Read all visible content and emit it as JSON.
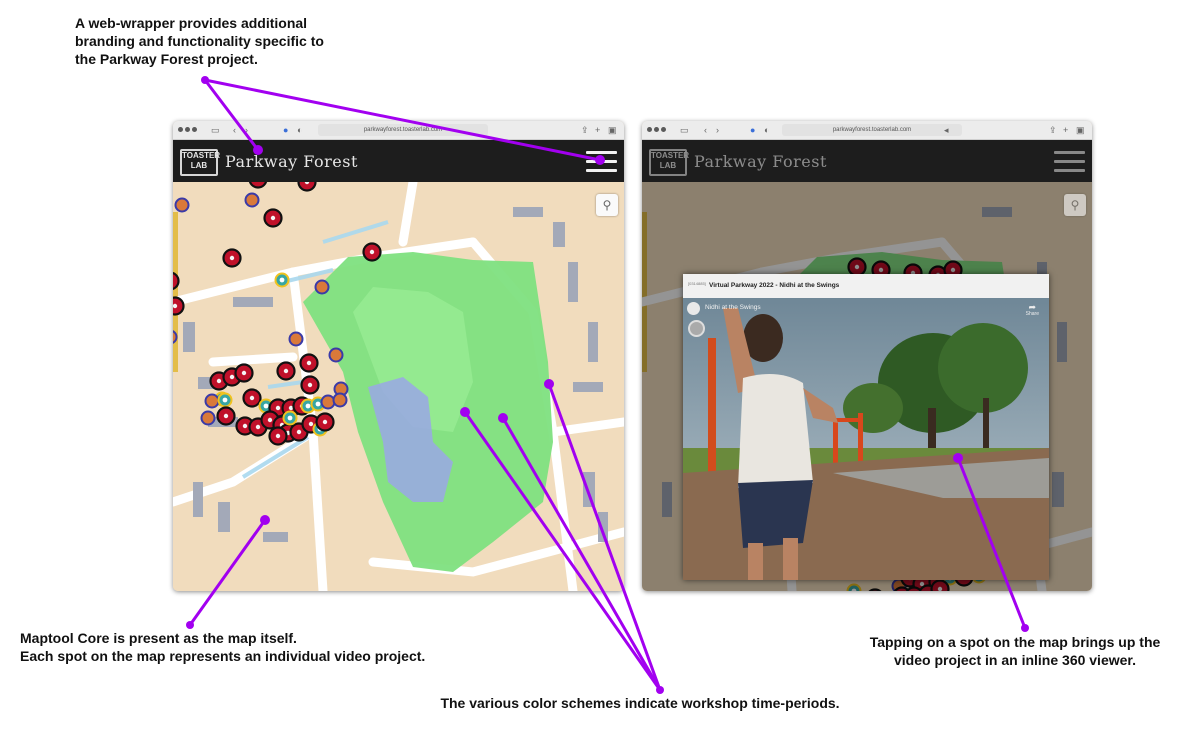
{
  "annotations": {
    "top": [
      "A web-wrapper provides additional",
      "branding and functionality specific to",
      "the Parkway Forest project."
    ],
    "left": [
      "Maptool Core is present as the map itself.",
      "Each spot on the map represents an individual video project."
    ],
    "right": [
      "Tapping on a spot on the map brings up the",
      "video project in an inline 360 viewer."
    ],
    "bottom": "The various color schemes indicate workshop time-periods.",
    "arrow_color": "#a200f0"
  },
  "browser_left": {
    "url": "parkwayforest.toasterlab.com",
    "app": {
      "logo_top": "TOASTER",
      "logo_bottom": "LAB",
      "title": "Parkway Forest"
    }
  },
  "browser_right": {
    "url": "parkwayforest.toasterlab.com",
    "app": {
      "logo_top": "TOASTER",
      "logo_bottom": "LAB",
      "title": "Parkway Forest"
    },
    "viewer": {
      "id_label": "[0314885]",
      "title": "Virtual Parkway 2022 - Nidhi at the Swings",
      "video_title": "Nidhi at the Swings",
      "share_label": "Share"
    }
  },
  "icons": {
    "location": "map-pin-icon",
    "menu": "hamburger-menu-icon",
    "share": "share-icon"
  },
  "marker_styles": {
    "red_period": {
      "fill": "#c0112a",
      "ring": "#111111",
      "center": "#f5f5f5"
    },
    "orange_period": {
      "fill": "#d9793a",
      "ring": "#3a3aa8",
      "center": "#d9793a"
    },
    "teal_period": {
      "fill": "#38a6a3",
      "ring": "#f0c21e",
      "center": "#ffffff"
    }
  },
  "map_colors": {
    "land": "#f1dcbd",
    "roads": "#ffffff",
    "park": "#7ee07f",
    "buildings": "#a3a9b8",
    "pool_area": "#9aa7e6"
  }
}
